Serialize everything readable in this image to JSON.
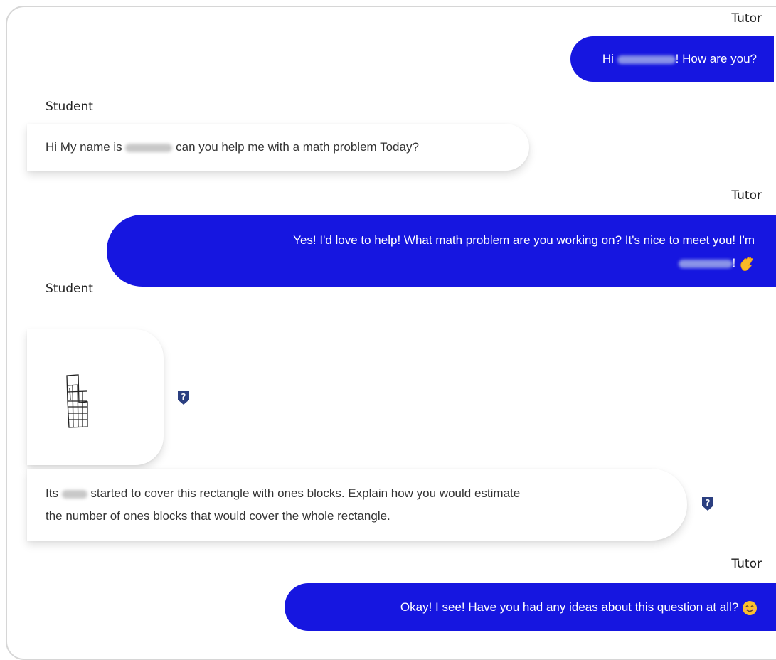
{
  "messages": [
    {
      "role": "Tutor",
      "parts": [
        "Hi ",
        "! How are you?"
      ]
    },
    {
      "role": "Student",
      "parts": [
        "Hi My name is ",
        " can you help me with a math problem Today?"
      ]
    },
    {
      "role": "Tutor",
      "line1": "Yes! I'd love to help! What math problem are you working on? It's nice to meet you! I'm",
      "line2_suffix": "! "
    },
    {
      "role": "Student",
      "attachment_icon": "grid-rectangle-sketch"
    },
    {
      "role": "Student",
      "line1_prefix": "Its ",
      "line1_suffix": " started to cover this rectangle with ones blocks. Explain how you would estimate",
      "line2": "the number of ones blocks that would cover the whole rectangle."
    },
    {
      "role": "Tutor",
      "text": "Okay! I see! Have you had any ideas about this question at all? "
    }
  ],
  "icons": {
    "help": "question-shield-icon",
    "wave": "waving-hand-emoji",
    "smile": "smiling-face-emoji"
  },
  "colors": {
    "tutor_bubble": "#1616e0",
    "student_bubble": "#ffffff",
    "help_badge": "#2b3f80"
  }
}
